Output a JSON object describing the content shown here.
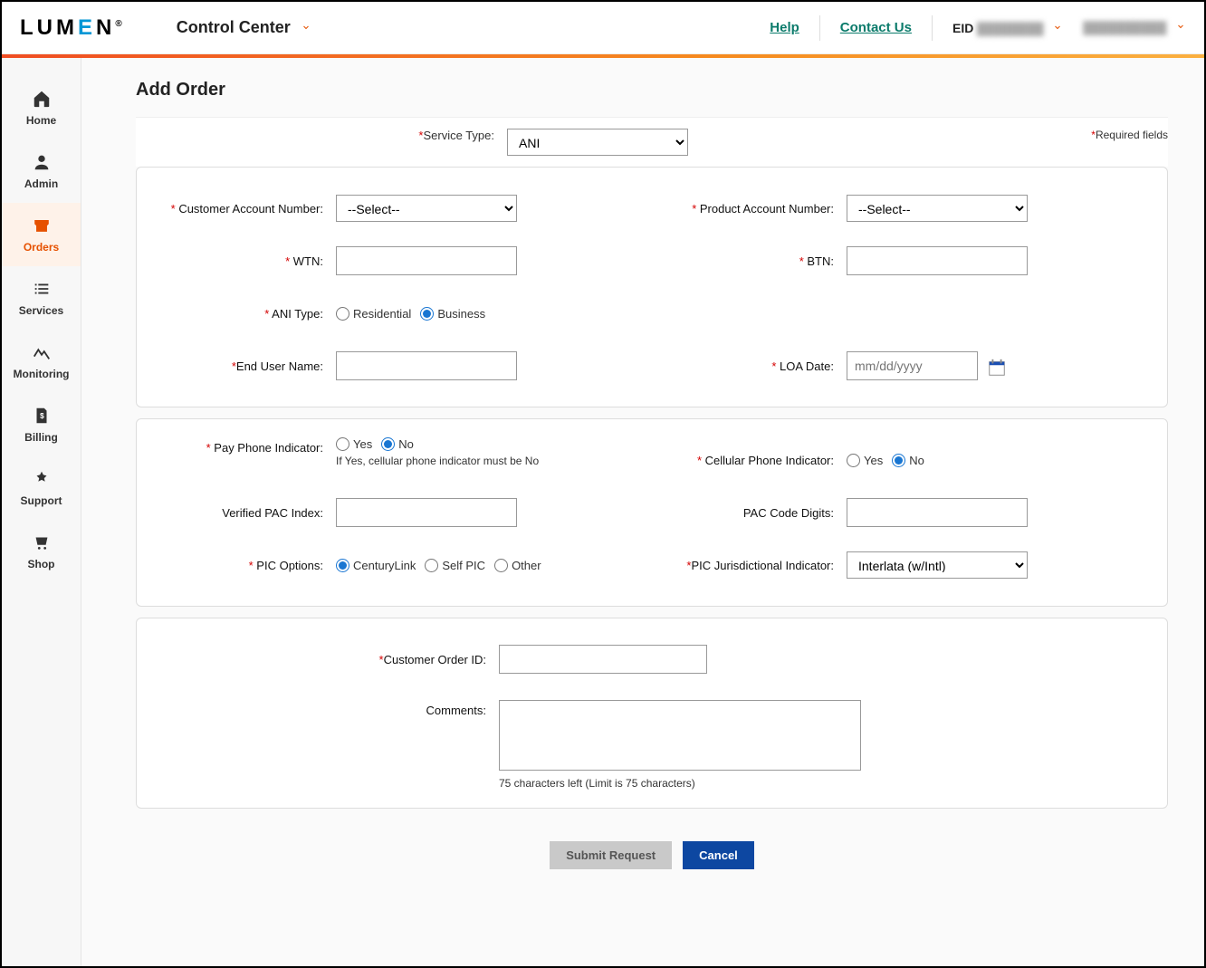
{
  "header": {
    "logo_parts": {
      "lum": "LUM",
      "e": "E",
      "n": "N"
    },
    "app_title": "Control Center",
    "help": "Help",
    "contact": "Contact Us",
    "eid_label": "EID"
  },
  "sidebar": {
    "items": [
      {
        "label": "Home"
      },
      {
        "label": "Admin"
      },
      {
        "label": "Orders"
      },
      {
        "label": "Services"
      },
      {
        "label": "Monitoring"
      },
      {
        "label": "Billing"
      },
      {
        "label": "Support"
      },
      {
        "label": "Shop"
      }
    ]
  },
  "page": {
    "title": "Add Order",
    "required_note": "Required fields"
  },
  "form": {
    "service_type": {
      "label": "Service Type:",
      "value": "ANI"
    },
    "customer_account": {
      "label": "Customer Account Number:",
      "placeholder": "--Select--"
    },
    "product_account": {
      "label": "Product Account Number:",
      "placeholder": "--Select--"
    },
    "wtn": {
      "label": "WTN:"
    },
    "btn": {
      "label": "BTN:"
    },
    "ani_type": {
      "label": "ANI Type:",
      "opt1": "Residential",
      "opt2": "Business",
      "selected": "Business"
    },
    "end_user": {
      "label": "End User Name:"
    },
    "loa_date": {
      "label": "LOA Date:",
      "placeholder": "mm/dd/yyyy"
    },
    "pay_phone": {
      "label": "Pay Phone Indicator:",
      "opt1": "Yes",
      "opt2": "No",
      "selected": "No",
      "hint": "If Yes, cellular phone indicator must be No"
    },
    "cell_phone": {
      "label": "Cellular Phone Indicator:",
      "opt1": "Yes",
      "opt2": "No",
      "selected": "No"
    },
    "pac_index": {
      "label": "Verified PAC Index:"
    },
    "pac_code": {
      "label": "PAC Code Digits:"
    },
    "pic_options": {
      "label": "PIC Options:",
      "opt1": "CenturyLink",
      "opt2": "Self PIC",
      "opt3": "Other",
      "selected": "CenturyLink"
    },
    "pic_juris": {
      "label": "PIC Jurisdictional Indicator:",
      "value": "Interlata (w/Intl)"
    },
    "customer_order_id": {
      "label": "Customer Order ID:"
    },
    "comments": {
      "label": "Comments:",
      "hint": "75 characters left (Limit is 75 characters)"
    }
  },
  "buttons": {
    "submit": "Submit Request",
    "cancel": "Cancel"
  }
}
